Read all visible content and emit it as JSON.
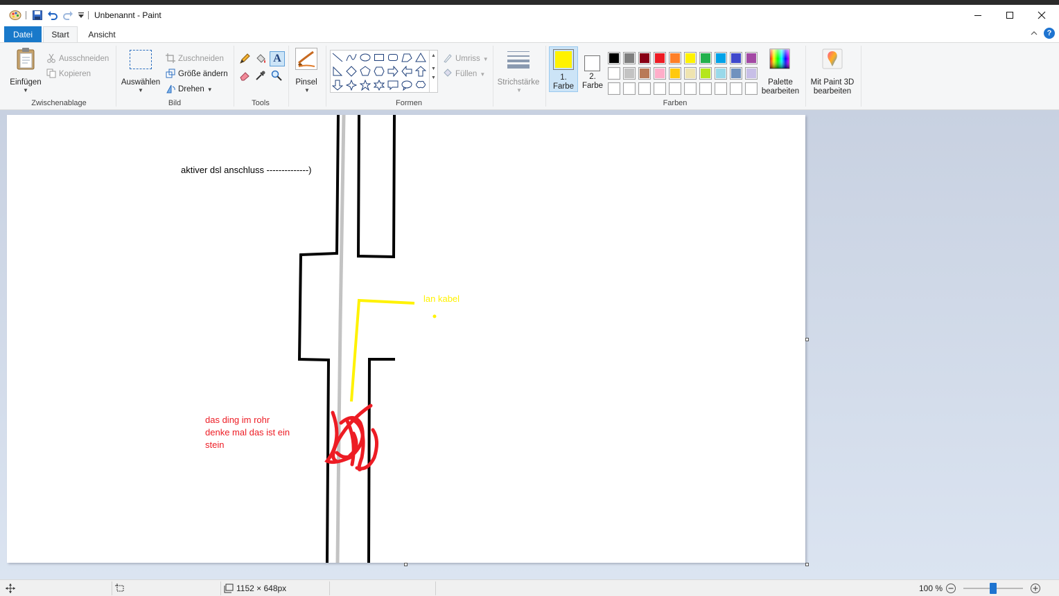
{
  "window": {
    "title": "Unbenannt - Paint"
  },
  "tabs": {
    "file": "Datei",
    "start": "Start",
    "view": "Ansicht"
  },
  "ribbon": {
    "clipboard": {
      "paste": "Einfügen",
      "cut": "Ausschneiden",
      "copy": "Kopieren",
      "group": "Zwischenablage"
    },
    "image": {
      "select": "Auswählen",
      "crop": "Zuschneiden",
      "resize": "Größe ändern",
      "rotate": "Drehen",
      "group": "Bild"
    },
    "tools": {
      "group": "Tools",
      "text_tool": "A"
    },
    "brush": {
      "label": "Pinsel"
    },
    "shapes": {
      "outline": "Umriss",
      "fill": "Füllen",
      "group": "Formen"
    },
    "size": {
      "label": "Strichstärke"
    },
    "colors": {
      "color1_line1": "1.",
      "color1_line2": "Farbe",
      "color2_line1": "2.",
      "color2_line2": "Farbe",
      "color1_value": "#fff200",
      "color2_value": "#ffffff",
      "edit_line1": "Palette",
      "edit_line2": "bearbeiten",
      "group": "Farben",
      "palette_row1": [
        "#000000",
        "#7f7f7f",
        "#880015",
        "#ed1c24",
        "#ff7f27",
        "#fff200",
        "#22b14c",
        "#00a2e8",
        "#3f48cc",
        "#a349a4"
      ],
      "palette_row2": [
        "#ffffff",
        "#c3c3c3",
        "#b97a57",
        "#ffaec9",
        "#ffc90e",
        "#efe4b0",
        "#b5e61d",
        "#99d9ea",
        "#7092be",
        "#c8bfe7"
      ]
    },
    "paint3d": {
      "line1": "Mit Paint 3D",
      "line2": "bearbeiten"
    }
  },
  "canvas": {
    "text_dsl": "aktiver dsl anschluss --------------)",
    "text_lan": "lan kabel",
    "text_stone_1": "das ding im rohr",
    "text_stone_2": "denke mal das ist ein",
    "text_stone_3": "stein",
    "color_text_dsl": "#000000",
    "color_text_lan": "#fff200",
    "color_text_stone": "#ed1c24"
  },
  "statusbar": {
    "dimensions": "1152 × 648px",
    "zoom": "100 %",
    "zoom_slider_fraction": 0.5
  }
}
